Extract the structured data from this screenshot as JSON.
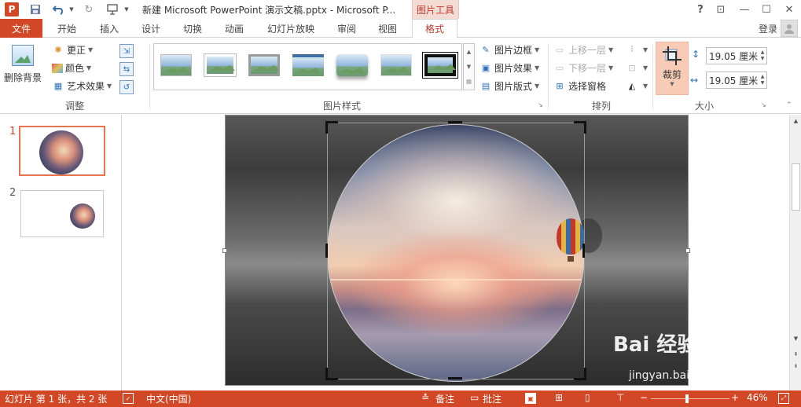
{
  "titlebar": {
    "logo": "P",
    "doc_title": "新建 Microsoft PowerPoint 演示文稿.pptx - Microsoft P...",
    "tool_tab": "图片工具",
    "help": "?",
    "controls": {
      "restore_ribbon": "⊡",
      "minimize": "—",
      "maximize": "☐",
      "close": "✕"
    }
  },
  "tabs": [
    "文件",
    "开始",
    "插入",
    "设计",
    "切换",
    "动画",
    "幻灯片放映",
    "审阅",
    "视图",
    "格式"
  ],
  "active_tab": "格式",
  "account": {
    "login": "登录"
  },
  "ribbon": {
    "adjust": {
      "label": "调整",
      "remove_background": "删除背景",
      "corrections": "更正",
      "color": "颜色",
      "artistic_effects": "艺术效果"
    },
    "picture_styles": {
      "label": "图片样式",
      "border": "图片边框",
      "effects": "图片效果",
      "layout": "图片版式"
    },
    "arrange": {
      "label": "排列",
      "bring_forward": "上移一层",
      "send_backward": "下移一层",
      "selection_pane": "选择窗格"
    },
    "size": {
      "label": "大小",
      "crop": "裁剪",
      "height_value": "19.05 厘米",
      "width_value": "19.05 厘米"
    }
  },
  "slides": [
    {
      "number": "1",
      "selected": true
    },
    {
      "number": "2",
      "selected": false
    }
  ],
  "statusbar": {
    "slide_info": "幻灯片 第 1 张，共 2 张",
    "language": "中文(中国)",
    "notes": "备注",
    "comments": "批注",
    "zoom_minus": "−",
    "zoom_plus": "+",
    "zoom": "46%"
  },
  "watermark": {
    "brand": "Bai 经验",
    "url": "jingyan.baidu.com"
  },
  "colors": {
    "accent": "#d24726",
    "selection": "#e8734f",
    "tool_tab_bg": "#f4dcd5"
  },
  "icons": [
    "powerpoint-logo-icon",
    "save-icon",
    "undo-icon",
    "redo-icon",
    "present-icon",
    "help-icon",
    "crop-icon"
  ]
}
